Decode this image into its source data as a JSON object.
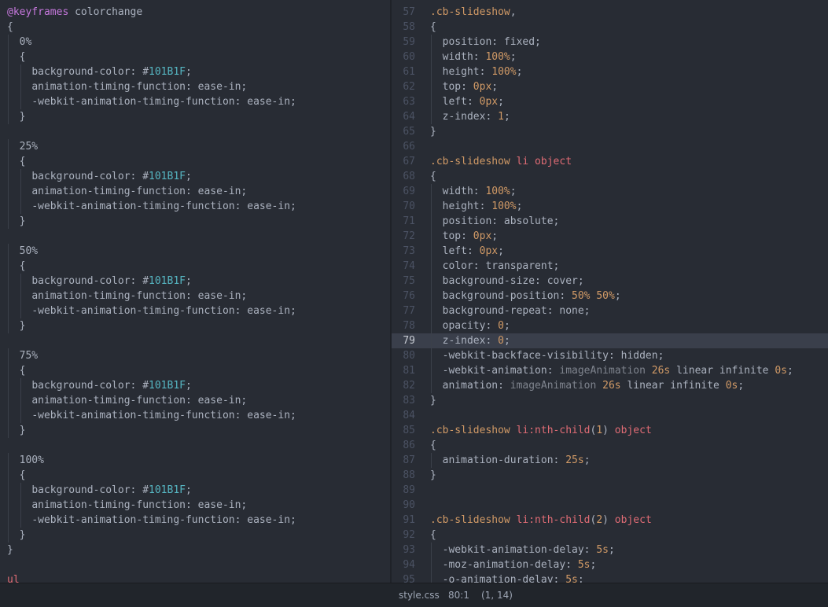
{
  "colors": {
    "background": "#282c34",
    "status_bar_background": "#21252b",
    "keyword_at": "#c678dd",
    "selector": "#d19a66",
    "element": "#e06c75",
    "number": "#d19a66",
    "hex_value": "#56b6c2",
    "text": "#abb2bf",
    "line_number": "#4b5263",
    "active_line": "#3a3f4b"
  },
  "left_editor": {
    "lines": [
      {
        "indent": 0,
        "tokens": [
          {
            "t": "@keyframes",
            "c": "at"
          },
          {
            "t": " colorchange",
            "c": "plain"
          }
        ]
      },
      {
        "indent": 0,
        "tokens": [
          {
            "t": "{",
            "c": "punct"
          }
        ]
      },
      {
        "indent": 1,
        "tokens": [
          {
            "t": "0%",
            "c": "plain"
          }
        ]
      },
      {
        "indent": 1,
        "tokens": [
          {
            "t": "{",
            "c": "punct"
          }
        ]
      },
      {
        "indent": 2,
        "tokens": [
          {
            "t": "background-color: ",
            "c": "prop"
          },
          {
            "t": "#",
            "c": "hash"
          },
          {
            "t": "101B1F",
            "c": "hex"
          },
          {
            "t": ";",
            "c": "punct"
          }
        ]
      },
      {
        "indent": 2,
        "tokens": [
          {
            "t": "animation-timing-function: ease-in;",
            "c": "prop"
          }
        ]
      },
      {
        "indent": 2,
        "tokens": [
          {
            "t": "-webkit-animation-timing-function: ease-in;",
            "c": "prop"
          }
        ]
      },
      {
        "indent": 1,
        "tokens": [
          {
            "t": "}",
            "c": "punct"
          }
        ]
      },
      {
        "indent": 0,
        "tokens": []
      },
      {
        "indent": 1,
        "tokens": [
          {
            "t": "25%",
            "c": "plain"
          }
        ]
      },
      {
        "indent": 1,
        "tokens": [
          {
            "t": "{",
            "c": "punct"
          }
        ]
      },
      {
        "indent": 2,
        "tokens": [
          {
            "t": "background-color: ",
            "c": "prop"
          },
          {
            "t": "#",
            "c": "hash"
          },
          {
            "t": "101B1F",
            "c": "hex"
          },
          {
            "t": ";",
            "c": "punct"
          }
        ]
      },
      {
        "indent": 2,
        "tokens": [
          {
            "t": "animation-timing-function: ease-in;",
            "c": "prop"
          }
        ]
      },
      {
        "indent": 2,
        "tokens": [
          {
            "t": "-webkit-animation-timing-function: ease-in;",
            "c": "prop"
          }
        ]
      },
      {
        "indent": 1,
        "tokens": [
          {
            "t": "}",
            "c": "punct"
          }
        ]
      },
      {
        "indent": 0,
        "tokens": []
      },
      {
        "indent": 1,
        "tokens": [
          {
            "t": "50%",
            "c": "plain"
          }
        ]
      },
      {
        "indent": 1,
        "tokens": [
          {
            "t": "{",
            "c": "punct"
          }
        ]
      },
      {
        "indent": 2,
        "tokens": [
          {
            "t": "background-color: ",
            "c": "prop"
          },
          {
            "t": "#",
            "c": "hash"
          },
          {
            "t": "101B1F",
            "c": "hex"
          },
          {
            "t": ";",
            "c": "punct"
          }
        ]
      },
      {
        "indent": 2,
        "tokens": [
          {
            "t": "animation-timing-function: ease-in;",
            "c": "prop"
          }
        ]
      },
      {
        "indent": 2,
        "tokens": [
          {
            "t": "-webkit-animation-timing-function: ease-in;",
            "c": "prop"
          }
        ]
      },
      {
        "indent": 1,
        "tokens": [
          {
            "t": "}",
            "c": "punct"
          }
        ]
      },
      {
        "indent": 0,
        "tokens": []
      },
      {
        "indent": 1,
        "tokens": [
          {
            "t": "75%",
            "c": "plain"
          }
        ]
      },
      {
        "indent": 1,
        "tokens": [
          {
            "t": "{",
            "c": "punct"
          }
        ]
      },
      {
        "indent": 2,
        "tokens": [
          {
            "t": "background-color: ",
            "c": "prop"
          },
          {
            "t": "#",
            "c": "hash"
          },
          {
            "t": "101B1F",
            "c": "hex"
          },
          {
            "t": ";",
            "c": "punct"
          }
        ]
      },
      {
        "indent": 2,
        "tokens": [
          {
            "t": "animation-timing-function: ease-in;",
            "c": "prop"
          }
        ]
      },
      {
        "indent": 2,
        "tokens": [
          {
            "t": "-webkit-animation-timing-function: ease-in;",
            "c": "prop"
          }
        ]
      },
      {
        "indent": 1,
        "tokens": [
          {
            "t": "}",
            "c": "punct"
          }
        ]
      },
      {
        "indent": 0,
        "tokens": []
      },
      {
        "indent": 1,
        "tokens": [
          {
            "t": "100%",
            "c": "plain"
          }
        ]
      },
      {
        "indent": 1,
        "tokens": [
          {
            "t": "{",
            "c": "punct"
          }
        ]
      },
      {
        "indent": 2,
        "tokens": [
          {
            "t": "background-color: ",
            "c": "prop"
          },
          {
            "t": "#",
            "c": "hash"
          },
          {
            "t": "101B1F",
            "c": "hex"
          },
          {
            "t": ";",
            "c": "punct"
          }
        ]
      },
      {
        "indent": 2,
        "tokens": [
          {
            "t": "animation-timing-function: ease-in;",
            "c": "prop"
          }
        ]
      },
      {
        "indent": 2,
        "tokens": [
          {
            "t": "-webkit-animation-timing-function: ease-in;",
            "c": "prop"
          }
        ]
      },
      {
        "indent": 1,
        "tokens": [
          {
            "t": "}",
            "c": "punct"
          }
        ]
      },
      {
        "indent": 0,
        "tokens": [
          {
            "t": "}",
            "c": "punct"
          }
        ]
      },
      {
        "indent": 0,
        "tokens": []
      },
      {
        "indent": 0,
        "tokens": [
          {
            "t": "ul",
            "c": "element"
          }
        ]
      }
    ]
  },
  "right_editor": {
    "active_line": "79",
    "lines": [
      {
        "num": "56",
        "indent": 0,
        "tokens": []
      },
      {
        "num": "57",
        "indent": 0,
        "tokens": [
          {
            "t": ".cb-slideshow",
            "c": "selector"
          },
          {
            "t": ",",
            "c": "punct"
          }
        ]
      },
      {
        "num": "58",
        "indent": 0,
        "tokens": [
          {
            "t": "{",
            "c": "punct"
          }
        ]
      },
      {
        "num": "59",
        "indent": 1,
        "tokens": [
          {
            "t": "position: fixed;",
            "c": "prop"
          }
        ]
      },
      {
        "num": "60",
        "indent": 1,
        "tokens": [
          {
            "t": "width: ",
            "c": "prop"
          },
          {
            "t": "100%",
            "c": "number"
          },
          {
            "t": ";",
            "c": "punct"
          }
        ]
      },
      {
        "num": "61",
        "indent": 1,
        "tokens": [
          {
            "t": "height: ",
            "c": "prop"
          },
          {
            "t": "100%",
            "c": "number"
          },
          {
            "t": ";",
            "c": "punct"
          }
        ]
      },
      {
        "num": "62",
        "indent": 1,
        "tokens": [
          {
            "t": "top: ",
            "c": "prop"
          },
          {
            "t": "0px",
            "c": "number"
          },
          {
            "t": ";",
            "c": "punct"
          }
        ]
      },
      {
        "num": "63",
        "indent": 1,
        "tokens": [
          {
            "t": "left: ",
            "c": "prop"
          },
          {
            "t": "0px",
            "c": "number"
          },
          {
            "t": ";",
            "c": "punct"
          }
        ]
      },
      {
        "num": "64",
        "indent": 1,
        "tokens": [
          {
            "t": "z-index: ",
            "c": "prop"
          },
          {
            "t": "1",
            "c": "number"
          },
          {
            "t": ";",
            "c": "punct"
          }
        ]
      },
      {
        "num": "65",
        "indent": 0,
        "tokens": [
          {
            "t": "}",
            "c": "punct"
          }
        ]
      },
      {
        "num": "66",
        "indent": 0,
        "tokens": []
      },
      {
        "num": "67",
        "indent": 0,
        "tokens": [
          {
            "t": ".cb-slideshow",
            "c": "selector"
          },
          {
            "t": " li object",
            "c": "element"
          }
        ]
      },
      {
        "num": "68",
        "indent": 0,
        "tokens": [
          {
            "t": "{",
            "c": "punct"
          }
        ]
      },
      {
        "num": "69",
        "indent": 1,
        "tokens": [
          {
            "t": "width: ",
            "c": "prop"
          },
          {
            "t": "100%",
            "c": "number"
          },
          {
            "t": ";",
            "c": "punct"
          }
        ]
      },
      {
        "num": "70",
        "indent": 1,
        "tokens": [
          {
            "t": "height: ",
            "c": "prop"
          },
          {
            "t": "100%",
            "c": "number"
          },
          {
            "t": ";",
            "c": "punct"
          }
        ]
      },
      {
        "num": "71",
        "indent": 1,
        "tokens": [
          {
            "t": "position: absolute;",
            "c": "prop"
          }
        ]
      },
      {
        "num": "72",
        "indent": 1,
        "tokens": [
          {
            "t": "top: ",
            "c": "prop"
          },
          {
            "t": "0px",
            "c": "number"
          },
          {
            "t": ";",
            "c": "punct"
          }
        ]
      },
      {
        "num": "73",
        "indent": 1,
        "tokens": [
          {
            "t": "left: ",
            "c": "prop"
          },
          {
            "t": "0px",
            "c": "number"
          },
          {
            "t": ";",
            "c": "punct"
          }
        ]
      },
      {
        "num": "74",
        "indent": 1,
        "tokens": [
          {
            "t": "color: transparent;",
            "c": "prop"
          }
        ]
      },
      {
        "num": "75",
        "indent": 1,
        "tokens": [
          {
            "t": "background-size: cover;",
            "c": "prop"
          }
        ]
      },
      {
        "num": "76",
        "indent": 1,
        "tokens": [
          {
            "t": "background-position: ",
            "c": "prop"
          },
          {
            "t": "50% 50%",
            "c": "number"
          },
          {
            "t": ";",
            "c": "punct"
          }
        ]
      },
      {
        "num": "77",
        "indent": 1,
        "tokens": [
          {
            "t": "background-repeat: none;",
            "c": "prop"
          }
        ]
      },
      {
        "num": "78",
        "indent": 1,
        "tokens": [
          {
            "t": "opacity: ",
            "c": "prop"
          },
          {
            "t": "0",
            "c": "number"
          },
          {
            "t": ";",
            "c": "punct"
          }
        ]
      },
      {
        "num": "79",
        "indent": 1,
        "tokens": [
          {
            "t": "z-index: ",
            "c": "prop"
          },
          {
            "t": "0",
            "c": "number"
          },
          {
            "t": ";",
            "c": "punct"
          }
        ]
      },
      {
        "num": "80",
        "indent": 1,
        "tokens": [
          {
            "t": "-webkit-backface-visibility: hidden;",
            "c": "prop"
          }
        ]
      },
      {
        "num": "81",
        "indent": 1,
        "tokens": [
          {
            "t": "-webkit-animation: ",
            "c": "prop"
          },
          {
            "t": "imageAnimation",
            "c": "dim"
          },
          {
            "t": " ",
            "c": "plain"
          },
          {
            "t": "26s",
            "c": "number"
          },
          {
            "t": " linear infinite ",
            "c": "prop"
          },
          {
            "t": "0s",
            "c": "number"
          },
          {
            "t": ";",
            "c": "punct"
          }
        ]
      },
      {
        "num": "82",
        "indent": 1,
        "tokens": [
          {
            "t": "animation: ",
            "c": "prop"
          },
          {
            "t": "imageAnimation",
            "c": "dim"
          },
          {
            "t": " ",
            "c": "plain"
          },
          {
            "t": "26s",
            "c": "number"
          },
          {
            "t": " linear infinite ",
            "c": "prop"
          },
          {
            "t": "0s",
            "c": "number"
          },
          {
            "t": ";",
            "c": "punct"
          }
        ]
      },
      {
        "num": "83",
        "indent": 0,
        "tokens": [
          {
            "t": "}",
            "c": "punct"
          }
        ]
      },
      {
        "num": "84",
        "indent": 0,
        "tokens": []
      },
      {
        "num": "85",
        "indent": 0,
        "tokens": [
          {
            "t": ".cb-slideshow",
            "c": "selector"
          },
          {
            "t": " li:nth-child",
            "c": "element"
          },
          {
            "t": "(",
            "c": "punct"
          },
          {
            "t": "1",
            "c": "number"
          },
          {
            "t": ")",
            "c": "punct"
          },
          {
            "t": " object",
            "c": "element"
          }
        ]
      },
      {
        "num": "86",
        "indent": 0,
        "tokens": [
          {
            "t": "{",
            "c": "punct"
          }
        ]
      },
      {
        "num": "87",
        "indent": 1,
        "tokens": [
          {
            "t": "animation-duration: ",
            "c": "prop"
          },
          {
            "t": "25s",
            "c": "number"
          },
          {
            "t": ";",
            "c": "punct"
          }
        ]
      },
      {
        "num": "88",
        "indent": 0,
        "tokens": [
          {
            "t": "}",
            "c": "punct"
          }
        ]
      },
      {
        "num": "89",
        "indent": 0,
        "tokens": []
      },
      {
        "num": "90",
        "indent": 0,
        "tokens": []
      },
      {
        "num": "91",
        "indent": 0,
        "tokens": [
          {
            "t": ".cb-slideshow",
            "c": "selector"
          },
          {
            "t": " li:nth-child",
            "c": "element"
          },
          {
            "t": "(",
            "c": "punct"
          },
          {
            "t": "2",
            "c": "number"
          },
          {
            "t": ")",
            "c": "punct"
          },
          {
            "t": " object",
            "c": "element"
          }
        ]
      },
      {
        "num": "92",
        "indent": 0,
        "tokens": [
          {
            "t": "{",
            "c": "punct"
          }
        ]
      },
      {
        "num": "93",
        "indent": 1,
        "tokens": [
          {
            "t": "-webkit-animation-delay: ",
            "c": "prop"
          },
          {
            "t": "5s",
            "c": "number"
          },
          {
            "t": ";",
            "c": "punct"
          }
        ]
      },
      {
        "num": "94",
        "indent": 1,
        "tokens": [
          {
            "t": "-moz-animation-delay: ",
            "c": "prop"
          },
          {
            "t": "5s",
            "c": "number"
          },
          {
            "t": ";",
            "c": "punct"
          }
        ]
      },
      {
        "num": "95",
        "indent": 1,
        "tokens": [
          {
            "t": "-o-animation-delay: ",
            "c": "prop"
          },
          {
            "t": "5s",
            "c": "number"
          },
          {
            "t": ";",
            "c": "punct"
          }
        ]
      }
    ]
  },
  "status_bar": {
    "file_name": "style.css",
    "cursor_position": "80:1",
    "selection": "(1, 14)"
  }
}
